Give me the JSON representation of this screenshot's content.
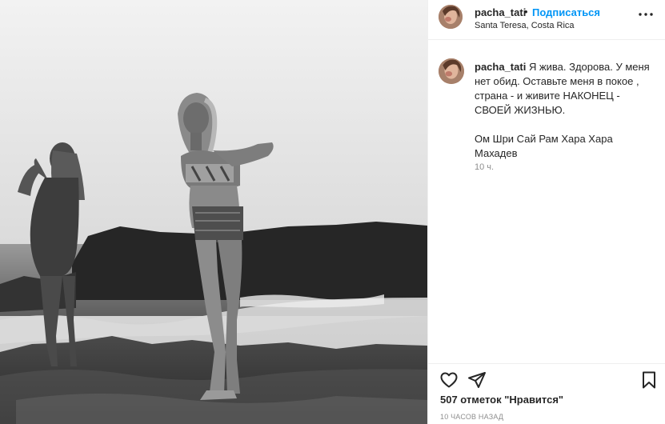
{
  "post": {
    "username": "pacha_tati",
    "separator": "•",
    "follow_label": "Подписаться",
    "location": "Santa Teresa, Costa Rica",
    "more_icon": "more-horizontal-icon"
  },
  "caption": {
    "username": "pacha_tati",
    "text_line1": "Я жива. Здорова. У меня нет обид. Оставьте меня в покое , страна - и живите НАКОНЕЦ - СВОЕЙ ЖИЗНЬЮ.",
    "text_line2": "Ом Шри Сай Рам Хара Хара Махадев",
    "time": "10 ч."
  },
  "actions": {
    "like_icon": "heart-icon",
    "share_icon": "paper-plane-icon",
    "save_icon": "bookmark-icon",
    "likes_text": "507 отметок \"Нравится\"",
    "posted_ago": "10 ЧАСОВ НАЗАД"
  },
  "colors": {
    "follow": "#0095f6",
    "text": "#262626",
    "secondary": "#8e8e8e",
    "divider": "#efefef"
  }
}
